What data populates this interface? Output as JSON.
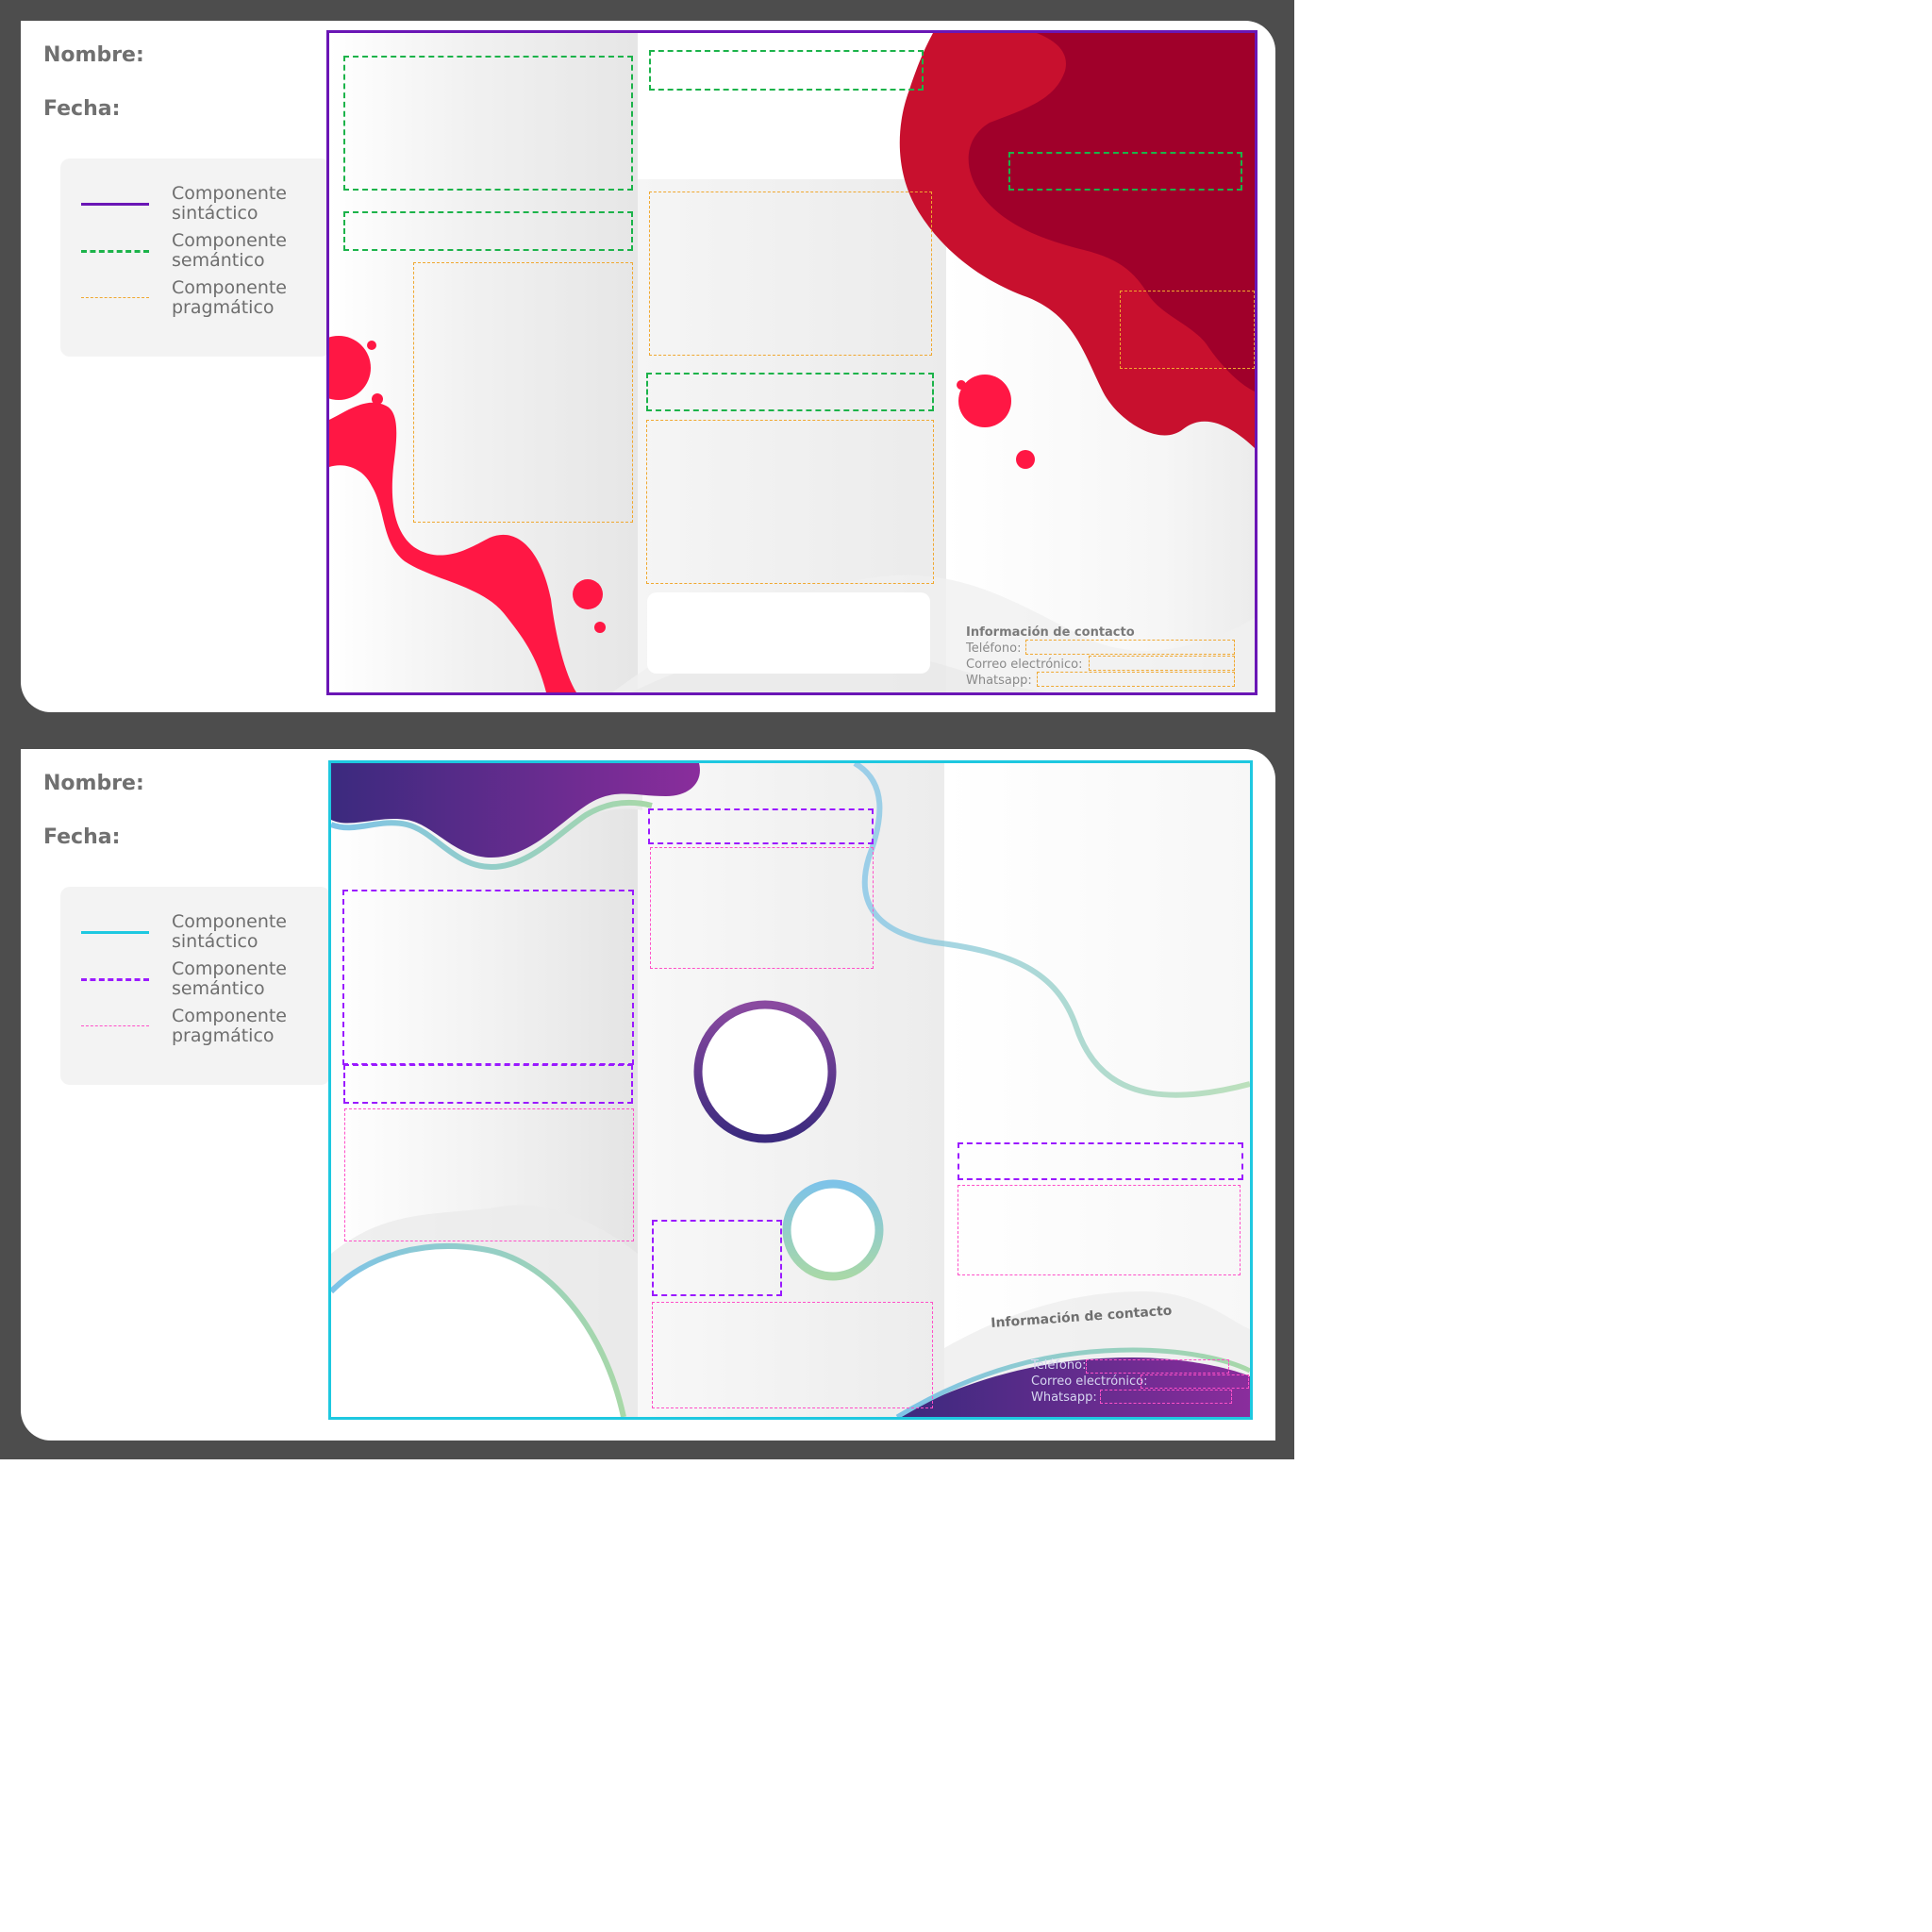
{
  "worksheets": [
    {
      "name_label": "Nombre:",
      "date_label": "Fecha:",
      "legend": [
        {
          "label": "Componente sintáctico",
          "line": "solid",
          "color": "#6a16b5"
        },
        {
          "label": "Componente semántico",
          "line": "dashed",
          "color": "#1cb34a"
        },
        {
          "label": "Componente pragmático",
          "line": "dotted",
          "color": "#f0a830"
        }
      ],
      "border_color": "#6a16b5",
      "accent_colors": [
        "#ff1744",
        "#c8102e",
        "#a0002a"
      ],
      "contact": {
        "title": "Información de contacto",
        "phone_label": "Teléfono:",
        "email_label": "Correo electrónico:",
        "whatsapp_label": "Whatsapp:"
      }
    },
    {
      "name_label": "Nombre:",
      "date_label": "Fecha:",
      "legend": [
        {
          "label": "Componente sintáctico",
          "line": "solid",
          "color": "#1ec8e0"
        },
        {
          "label": "Componente semántico",
          "line": "dashed",
          "color": "#9a1aff"
        },
        {
          "label": "Componente pragmático",
          "line": "dotted",
          "color": "#ff50c8"
        }
      ],
      "border_color": "#1ec8e0",
      "accent_colors": [
        "#3b2a7e",
        "#8a2d9c",
        "#7ec3e8",
        "#a8d8a8"
      ],
      "contact": {
        "title": "Información de contacto",
        "phone_label": "Teléfono:",
        "email_label": "Correo electrónico:",
        "whatsapp_label": "Whatsapp:"
      }
    }
  ]
}
